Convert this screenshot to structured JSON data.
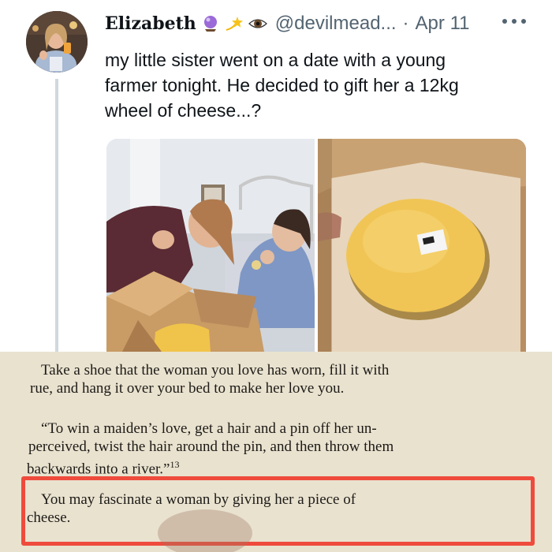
{
  "tweet": {
    "display_name": "Elizabeth",
    "emojis": [
      "crystal-ball-icon",
      "shooting-star-icon",
      "eye-icon"
    ],
    "handle": "@devilmead...",
    "separator": "·",
    "date": "Apr 11",
    "text_lines": [
      "my little sister went on a date with a young",
      "farmer tonight. He decided to gift her a 12kg",
      "wheel of cheese...?"
    ],
    "media": [
      {
        "name": "photo-girls-with-cheese-box"
      },
      {
        "name": "photo-cheese-wheel-in-box"
      }
    ]
  },
  "book": {
    "para1": [
      "Take a shoe that the woman you love has worn, fill it with",
      "rue, and hang it over your bed to make her love you."
    ],
    "para2": [
      "“To win a maiden’s love, get a hair and a pin off her un-",
      "perceived, twist the hair around the pin, and then throw them",
      "backwards into a river.”",
      "13"
    ],
    "para3": [
      "You may fascinate a woman by giving her a piece of",
      "cheese."
    ]
  },
  "colors": {
    "highlight": "#ef4b3d",
    "paper": "#e9e2cf",
    "link_gray": "#536471"
  }
}
